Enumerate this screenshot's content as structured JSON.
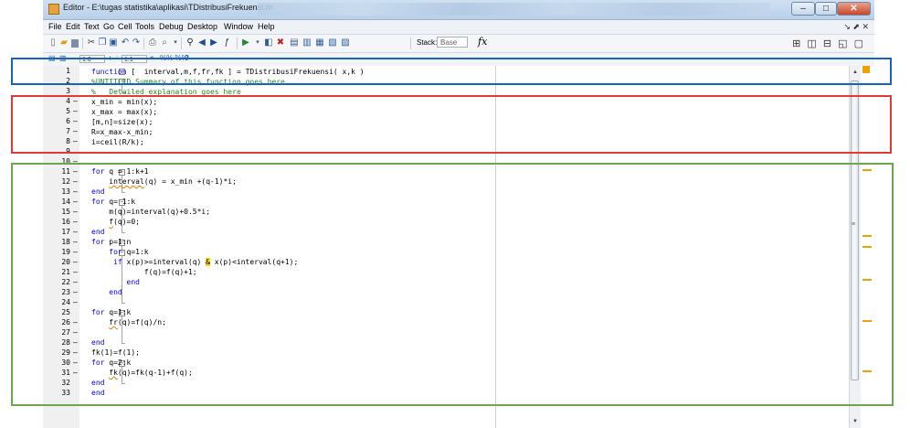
{
  "window": {
    "title": "Editor - E:\\tugas statistika\\aplikasi\\TDistribusiFrekuensi.m",
    "controls": [
      "–",
      "□",
      "✕"
    ]
  },
  "menu": [
    "File",
    "Edit",
    "Text",
    "Go",
    "Cell",
    "Tools",
    "Debug",
    "Desktop",
    "Window",
    "Help"
  ],
  "menu_dock": "↘ ⬈ ✕",
  "toolbar": {
    "icons": [
      "new-file-icon",
      "open-folder-icon",
      "save-icon",
      "cut-icon",
      "copy-icon",
      "paste-icon",
      "undo-icon",
      "redo-icon",
      "print-icon",
      "find-files-icon",
      "dropdown-icon",
      "find-icon",
      "back-arrow-icon",
      "forward-arrow-icon",
      "fx-browse-icon",
      "run-icon",
      "breakpoint-icon",
      "set-breakpoint-icon",
      "clear-breakpoint-icon",
      "step-icon",
      "step-in-icon",
      "step-out-icon",
      "exit-debug-icon"
    ],
    "stack_label": "Stack:",
    "stack_value": "Base",
    "fx": "fx",
    "layout_icons": "⊞ ◫ ⊟ ◱ ▢"
  },
  "cellbar": {
    "minus": "−",
    "input1": "1.0",
    "plus": "+",
    "divide": "÷",
    "input2": "1.1",
    "times": "×",
    "cell_icons": "%% %%",
    "help": "?"
  },
  "colors": {
    "keyword": "#0000ff",
    "comment": "#228b22",
    "blue_box": "#1565c0",
    "red_box": "#e53935",
    "green_box": "#6aa84f",
    "mlint_marker": "#f0a000"
  },
  "lines": [
    {
      "n": "1",
      "exec": false
    },
    {
      "n": "2",
      "exec": false
    },
    {
      "n": "3",
      "exec": false
    },
    {
      "n": "4",
      "exec": true
    },
    {
      "n": "5",
      "exec": true
    },
    {
      "n": "6",
      "exec": true
    },
    {
      "n": "7",
      "exec": true
    },
    {
      "n": "8",
      "exec": true
    },
    {
      "n": "9",
      "exec": false
    },
    {
      "n": "10",
      "exec": true
    },
    {
      "n": "11",
      "exec": true
    },
    {
      "n": "12",
      "exec": true
    },
    {
      "n": "13",
      "exec": true
    },
    {
      "n": "14",
      "exec": true
    },
    {
      "n": "15",
      "exec": true
    },
    {
      "n": "16",
      "exec": true
    },
    {
      "n": "17",
      "exec": true
    },
    {
      "n": "18",
      "exec": true
    },
    {
      "n": "19",
      "exec": true
    },
    {
      "n": "20",
      "exec": true
    },
    {
      "n": "21",
      "exec": true
    },
    {
      "n": "22",
      "exec": true
    },
    {
      "n": "23",
      "exec": true
    },
    {
      "n": "24",
      "exec": true
    },
    {
      "n": "25",
      "exec": false
    },
    {
      "n": "26",
      "exec": true
    },
    {
      "n": "27",
      "exec": true
    },
    {
      "n": "28",
      "exec": true
    },
    {
      "n": "29",
      "exec": true
    },
    {
      "n": "30",
      "exec": true
    },
    {
      "n": "31",
      "exec": true
    },
    {
      "n": "32",
      "exec": false
    },
    {
      "n": "33",
      "exec": false
    }
  ],
  "code": {
    "l1_kw": "function",
    "l1_rest": " [  interval,m,f,fr,fk ] = TDistribusiFrekuensi( x,k )",
    "l2": "%UNTITLED Summary of this function goes here",
    "l3": "%   Detailed explanation goes here",
    "l4": "x_min = min(x);",
    "l5": "x_max = max(x);",
    "l6": "[m,n]=size(x);",
    "l7": "R=x_max-x_min;",
    "l8": "i=ceil(R/k);",
    "l10_kw": "for",
    "l10_rest": " q = 1:k+1",
    "l11_a": "    ",
    "l11_w": "interval",
    "l11_b": "(q) = x_min +(q-1)*i;",
    "l12": "end",
    "l13_kw": "for",
    "l13_rest": " q= 1:k",
    "l14": "    m(q)=interval(q)+0.5*i;",
    "l15_a": "    ",
    "l15_w": "f",
    "l15_b": "(q)=0;",
    "l16": "end",
    "l17_kw": "for",
    "l17_rest": " p=1:n",
    "l18_a": "    ",
    "l18_kw": "for",
    "l18_b": " q=1:k",
    "l19_a": "    ",
    "l19_kw": "if",
    "l19_b": " x(p)>=interval(q) ",
    "l19_amp": "&",
    "l19_c": " x(p)<interval(q+1);",
    "l20": "            f(q)=f(q)+1;",
    "l21": "        end",
    "l22": "    end",
    "l23_kw": "for",
    "l23_rest": " q=1:k",
    "l24_a": "    ",
    "l24_w": "fr",
    "l24_b": "(q)=f(q)/n;",
    "l26": "end",
    "l27": "fk(1)=f(1);",
    "l28_kw": "for",
    "l28_rest": " q=2:k",
    "l29_a": "    ",
    "l29_w": "fk",
    "l29_b": "(q)=fk(q-1)+f(q);",
    "l30": "end",
    "l31": "end"
  },
  "scroll": {
    "grip": "≡",
    "up": "▲",
    "down": "▼"
  }
}
